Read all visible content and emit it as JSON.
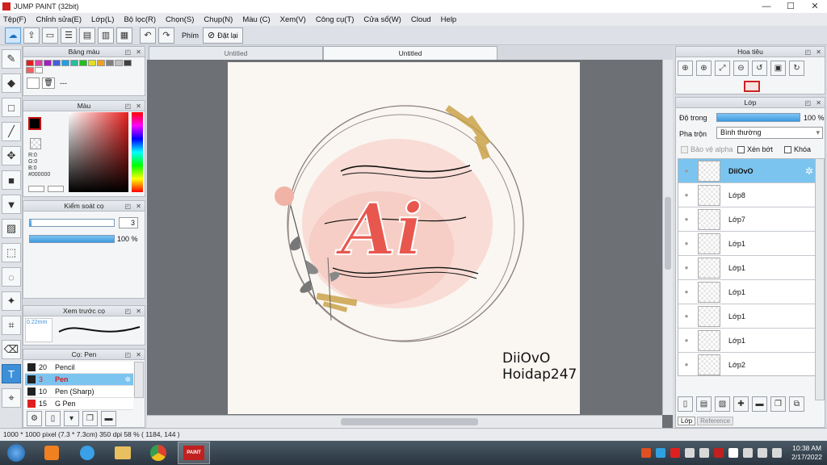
{
  "window": {
    "title": "JUMP PAINT (32bit)"
  },
  "menu": [
    "Tệp(F)",
    "Chỉnh sửa(E)",
    "Lớp(L)",
    "Bộ lọc(R)",
    "Chọn(S)",
    "Chụp(N)",
    "Màu (C)",
    "Xem(V)",
    "Công cụ(T)",
    "Cửa sổ(W)",
    "Cloud",
    "Help"
  ],
  "toolbar": {
    "shortcut_label": "Phím",
    "reset_label": "Đặt lại"
  },
  "palette_panel": {
    "title": "Bảng màu",
    "set_name": "---",
    "colors": [
      "#e02020",
      "#e040a0",
      "#a020c0",
      "#4060e0",
      "#20a0e0",
      "#20c0a0",
      "#20c020",
      "#e0e020",
      "#f0a020",
      "#808080",
      "#c0c0c0",
      "#404040",
      "#f06060",
      "#ffffff"
    ]
  },
  "color_panel": {
    "title": "Màu",
    "main_color": "#000000",
    "r": "R:0",
    "g": "G:0",
    "b": "B:0",
    "hex": "#000000"
  },
  "brush_control": {
    "title": "Kiểm soát cọ",
    "size": "3",
    "opacity": "100 %",
    "opacity_value": 1.0
  },
  "preview_panel": {
    "title": "Xem trước cọ",
    "size_label": "0.22mm"
  },
  "brush_list": {
    "title": "Cọ: Pen",
    "items": [
      {
        "size": "20",
        "name": "Pencil",
        "color": "#222222"
      },
      {
        "size": "3",
        "name": "Pen",
        "color": "#222222",
        "selected": true
      },
      {
        "size": "10",
        "name": "Pen (Sharp)",
        "color": "#222222"
      },
      {
        "size": "15",
        "name": "G Pen",
        "color": "#e02020"
      }
    ]
  },
  "tabs": [
    "Untitled",
    "Untitled"
  ],
  "canvas": {
    "text_line1": "DiiOvO",
    "text_line2": "Hoidap247",
    "logo_text": "Ai"
  },
  "navigator": {
    "title": "Hoa tiêu"
  },
  "layer_panel": {
    "title": "Lớp",
    "opacity_label": "Độ trong",
    "opacity_value": "100 %",
    "blend_label": "Pha trộn",
    "blend_mode": "Bình thường",
    "protect_alpha": "Bảo vệ alpha",
    "clip_label": "Xén bớt",
    "lock_label": "Khóa",
    "layers": [
      {
        "name": "DiiOvO",
        "selected": true
      },
      {
        "name": "Lớp8"
      },
      {
        "name": "Lớp7"
      },
      {
        "name": "Lớp1"
      },
      {
        "name": "Lớp1"
      },
      {
        "name": "Lớp1"
      },
      {
        "name": "Lớp1"
      },
      {
        "name": "Lớp1"
      },
      {
        "name": "Lớp2"
      }
    ],
    "bottom_tabs": [
      "Lớp",
      "Reference"
    ]
  },
  "status": {
    "text": "1000 * 1000 pixel   (7.3 * 7.3cm)   350 dpi   58 %   ( 1184, 144 )"
  },
  "taskbar": {
    "time": "10:38 AM",
    "date": "2/17/2022"
  }
}
